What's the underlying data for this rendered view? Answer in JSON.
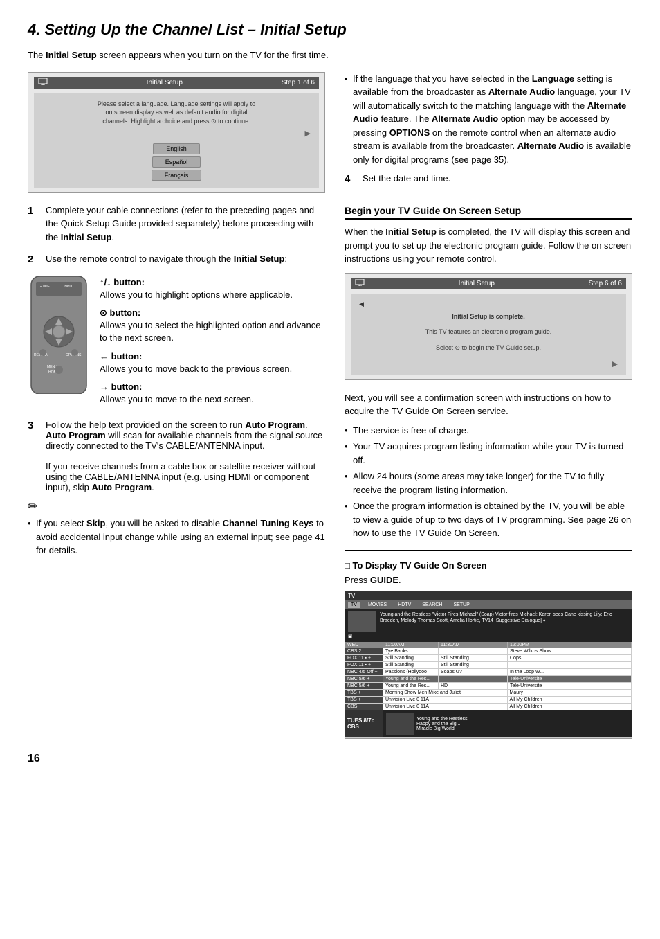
{
  "page": {
    "number": "16",
    "title": "4. Setting Up the Channel List – Initial Setup"
  },
  "intro": {
    "text": "The ",
    "bold": "Initial Setup",
    "text2": " screen appears when you turn on the TV for the first time."
  },
  "initial_setup_screen": {
    "header_label": "Initial Setup",
    "step_label": "Step 1 of 6",
    "body_text": "Please select a language. Language settings will apply to on screen display as well as default audio for digital channels. Highlight a choice and press",
    "body_text2": "to continue.",
    "languages": [
      "English",
      "Español",
      "Français"
    ]
  },
  "steps": [
    {
      "num": "1",
      "text": "Complete your cable connections (refer to the preceding pages and the Quick Setup Guide provided separately) before proceeding with the ",
      "bold": "Initial Setup",
      "text2": "."
    },
    {
      "num": "2",
      "text": "Use the remote control to navigate through the ",
      "bold": "Initial Setup",
      "text2": ":"
    }
  ],
  "buttons": {
    "up_down": {
      "label": "↑/↓ button:",
      "desc": "Allows you to highlight options where applicable."
    },
    "select": {
      "label": "⊙ button:",
      "desc": "Allows you to select the highlighted option and advance to the next screen."
    },
    "back": {
      "label": "← button:",
      "desc": "Allows you to move back to the previous screen."
    },
    "forward": {
      "label": "→ button:",
      "desc": "Allows you to move to the next screen."
    }
  },
  "step3": {
    "num": "3",
    "text": "Follow the help text provided on the screen to run ",
    "bold1": "Auto Program",
    "text2": ". ",
    "bold2": "Auto Program",
    "text3": " will scan for available channels from the signal source directly connected to the TV's CABLE/ANTENNA input.",
    "text4": "If you receive channels from a cable box or satellite receiver without using the CABLE/ANTENNA input (e.g. using HDMI or component input), skip ",
    "bold3": "Auto Program",
    "text5": "."
  },
  "note": {
    "text1": "If you select ",
    "bold1": "Skip",
    "text2": ", you will be asked to disable ",
    "bold2": "Channel Tuning Keys",
    "text3": " to avoid accidental input change while using an external input; see page 41 for details."
  },
  "right_col": {
    "bullets": [
      {
        "text": "If the language that you have selected in the ",
        "bold1": "Language",
        "text2": " setting is available from the broadcaster as ",
        "bold2": "Alternate Audio",
        "text3": " language, your TV will automatically switch to the matching language with the ",
        "bold3": "Alternate Audio",
        "text4": " feature. The ",
        "bold4": "Alternate Audio",
        "text5": " option may be accessed by pressing ",
        "bold5": "OPTIONS",
        "text6": " on the remote control when an alternate audio stream is available from the broadcaster. ",
        "bold6": "Alternate Audio",
        "text7": " is available only for digital programs (see page 35)."
      }
    ],
    "step4": {
      "num": "4",
      "text": "Set the date and time."
    },
    "tv_guide_section": {
      "heading": "Begin your TV Guide On Screen Setup",
      "intro": "When the ",
      "bold": "Initial Setup",
      "intro2": " is completed, the TV will display this screen and prompt you to set up the electronic program guide. Follow the on screen instructions using your remote control.",
      "screen": {
        "header_label": "Initial Setup",
        "step_label": "Step 6 of 6",
        "line1": "Initial Setup is complete.",
        "line2": "This TV features an electronic program guide.",
        "line3": "Select",
        "line4": "to begin the TV Guide setup."
      }
    },
    "confirmation_text": "Next, you will see a confirmation screen with instructions on how to acquire the TV Guide On Screen service.",
    "confirmation_bullets": [
      "The service is free of charge.",
      "Your TV acquires program listing information while your TV is turned off.",
      "Allow 24 hours (some areas may take longer) for the TV to fully receive the program listing information.",
      "Once the program information is obtained by the TV, you will be able to view a guide of up to two days of TV programming. See page 26 on how to use the TV Guide On Screen."
    ],
    "display_guide": {
      "heading": "□ To Display TV Guide On Screen",
      "text": "Press ",
      "bold": "GUIDE",
      "text2": "."
    }
  },
  "tv_guide_grid": {
    "tabs": [
      "TV",
      "MOVIES",
      "HDTV",
      "SEARCH",
      "SETUP"
    ],
    "info_bar": "Young and the Restless \"Victor Fires Michael\" (Soap) Victor fires Michael; Karen sees Cane kissing Lily; Eric Braeden, Melody Thomas Scott, Amelia Hortie, TV14 [Suggestive Dialogue] ♦",
    "timebar": [
      "WED",
      "11:00AM",
      "11:30AM",
      "12:00PM"
    ],
    "channels": [
      {
        "name": "CBS 2",
        "programs": [
          "Tye Banks",
          "",
          "Steve Wilkos Show"
        ]
      },
      {
        "name": "FOX 11",
        "programs": [
          "Still Standing",
          "Still Standing",
          "Cops"
        ]
      },
      {
        "name": "FOX 11",
        "programs": [
          "Still Standing",
          "Still Standing",
          ""
        ]
      },
      {
        "name": "NBC 4",
        "programs": [
          "Passions (Hollyooo",
          "Soaps U?",
          "In the Loop W..."
        ]
      },
      {
        "name": "NBC 5",
        "programs": [
          "Young and the Res...",
          "",
          "Tele-Universite"
        ]
      },
      {
        "name": "NBC 5/6",
        "programs": [
          "Young and the Res...",
          "HD",
          "Tele-Universite"
        ]
      },
      {
        "name": "TBS",
        "programs": [
          "Morning Show Men Mike and Juliet",
          "Maury",
          ""
        ]
      },
      {
        "name": "TBS",
        "programs": [
          "Univision Live 0 11A",
          "",
          "All My Children"
        ]
      },
      {
        "name": "CBS",
        "programs": [
          "Univision Live 0 11A",
          "",
          "All My Children"
        ]
      },
      {
        "name": "TUES 8/7c CBS",
        "programs": [
          "Young and the Restless",
          "Happy and the Big...",
          "Miracle Big World"
        ]
      }
    ]
  }
}
